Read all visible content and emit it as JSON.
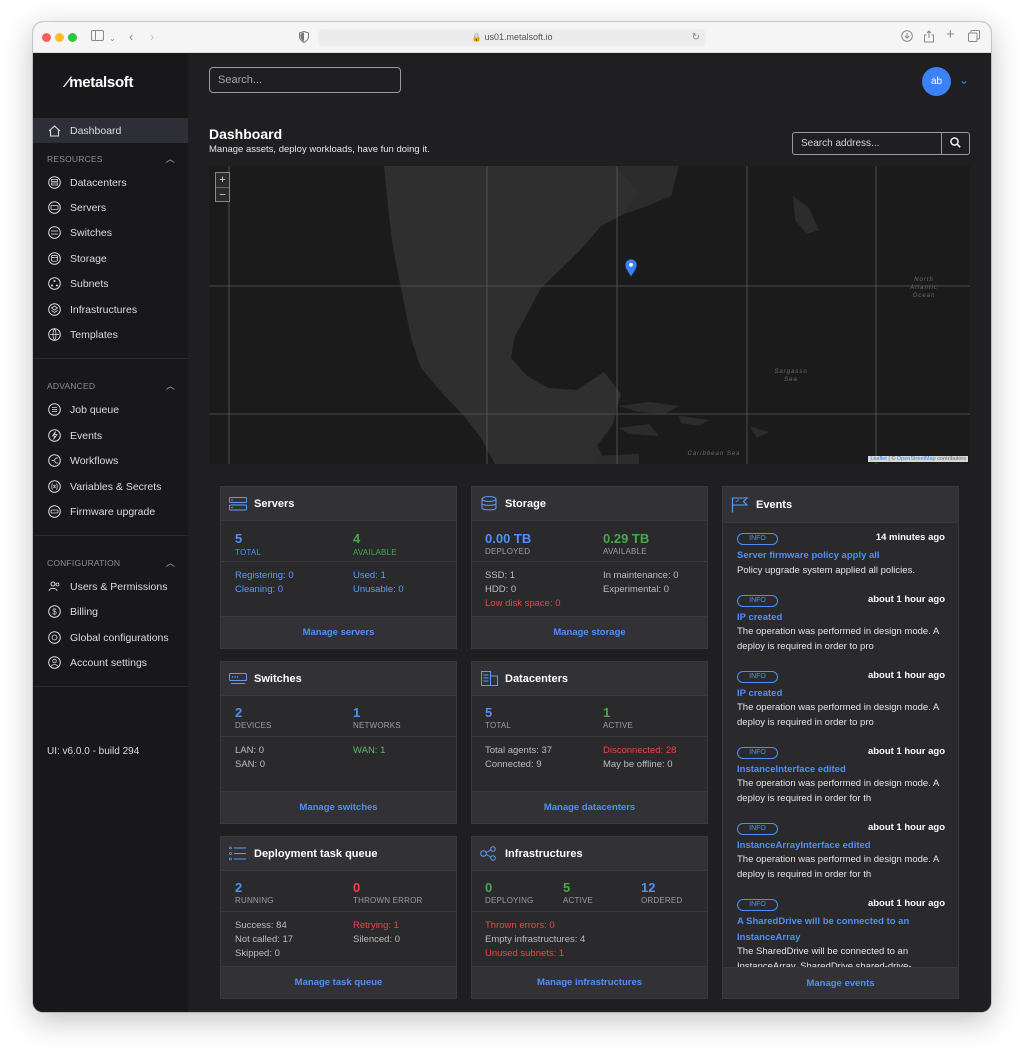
{
  "browser": {
    "url": "us01.metalsoft.io"
  },
  "sidebar": {
    "logo": "metalsoft",
    "dashboard": "Dashboard",
    "resources_heading": "RESOURCES",
    "resources": [
      "Datacenters",
      "Servers",
      "Switches",
      "Storage",
      "Subnets",
      "Infrastructures",
      "Templates"
    ],
    "advanced_heading": "ADVANCED",
    "advanced": [
      "Job queue",
      "Events",
      "Workflows",
      "Variables & Secrets",
      "Firmware upgrade"
    ],
    "configuration_heading": "CONFIGURATION",
    "configuration": [
      "Users & Permissions",
      "Billing",
      "Global configurations",
      "Account settings"
    ],
    "version": "UI: v6.0.0 - build 294"
  },
  "header": {
    "search_placeholder": "Search...",
    "avatar": "ab"
  },
  "page": {
    "title": "Dashboard",
    "subtitle": "Manage assets, deploy workloads, have fun doing it.",
    "address_placeholder": "Search address..."
  },
  "map": {
    "zoom_in": "+",
    "zoom_out": "−",
    "attribution_leaflet": "Leaflet",
    "attribution_sep": " | © ",
    "attribution_osm": "OpenStreetMap",
    "attribution_tail": " contributors",
    "labels": {
      "north_atlantic": "North Atlantic Ocean",
      "sargasso": "Sargasso Sea",
      "caribbean": "Caribbean Sea"
    }
  },
  "cards": {
    "servers": {
      "title": "Servers",
      "total": "5",
      "total_label": "TOTAL",
      "available": "4",
      "available_label": "AVAILABLE",
      "registering": "Registering: 0",
      "cleaning": "Cleaning: 0",
      "used": "Used: 1",
      "unusable": "Unusable: 0",
      "link": "Manage servers"
    },
    "storage": {
      "title": "Storage",
      "deployed": "0.00 TB",
      "deployed_label": "DEPLOYED",
      "available": "0.29 TB",
      "available_label": "AVAILABLE",
      "ssd": "SSD: 1",
      "hdd": "HDD: 0",
      "low_disk": "Low disk space: 0",
      "maintenance": "In maintenance: 0",
      "experimental": "Experimental: 0",
      "link": "Manage storage"
    },
    "switches": {
      "title": "Switches",
      "devices": "2",
      "devices_label": "DEVICES",
      "networks": "1",
      "networks_label": "NETWORKS",
      "lan": "LAN: 0",
      "san": "SAN: 0",
      "wan": "WAN: 1",
      "link": "Manage switches"
    },
    "datacenters": {
      "title": "Datacenters",
      "total": "5",
      "total_label": "TOTAL",
      "active": "1",
      "active_label": "ACTIVE",
      "agents": "Total agents: 37",
      "connected": "Connected: 9",
      "disconnected": "Disconnected: 28",
      "offline": "May be offline: 0",
      "link": "Manage datacenters"
    },
    "tasks": {
      "title": "Deployment task queue",
      "running": "2",
      "running_label": "RUNNING",
      "error": "0",
      "error_label": "THROWN ERROR",
      "success": "Success: 84",
      "not_called": "Not called: 17",
      "skipped": "Skipped: 0",
      "retrying": "Retrying: 1",
      "silenced": "Silenced: 0",
      "link": "Manage task queue"
    },
    "infrastructures": {
      "title": "Infrastructures",
      "deploying": "0",
      "deploying_label": "DEPLOYING",
      "active": "5",
      "active_label": "ACTIVE",
      "ordered": "12",
      "ordered_label": "ORDERED",
      "thrown": "Thrown errors: 0",
      "empty": "Empty infrastructures: 4",
      "unused": "Unused subnets: 1",
      "link": "Manage infrastructures"
    }
  },
  "events": {
    "title": "Events",
    "link": "Manage events",
    "items": [
      {
        "badge": "INFO",
        "time": "14 minutes ago",
        "title": "Server firmware policy apply all",
        "desc": "Policy upgrade system applied all policies."
      },
      {
        "badge": "INFO",
        "time": "about 1 hour ago",
        "title": "IP created",
        "desc": "The operation was performed in design mode. A deploy is required in order to pro"
      },
      {
        "badge": "INFO",
        "time": "about 1 hour ago",
        "title": "IP created",
        "desc": "The operation was performed in design mode. A deploy is required in order to pro"
      },
      {
        "badge": "INFO",
        "time": "about 1 hour ago",
        "title": "InstanceInterface edited",
        "desc": "The operation was performed in design mode. A deploy is required in order for th"
      },
      {
        "badge": "INFO",
        "time": "about 1 hour ago",
        "title": "InstanceArrayInterface edited",
        "desc": "The operation was performed in design mode. A deploy is required in order for th"
      },
      {
        "badge": "INFO",
        "time": "about 1 hour ago",
        "title": "A SharedDrive will be connected to an InstanceArray",
        "desc": "The SharedDrive will be connected to an InstanceArray. SharedDrive shared-drive-"
      }
    ]
  }
}
